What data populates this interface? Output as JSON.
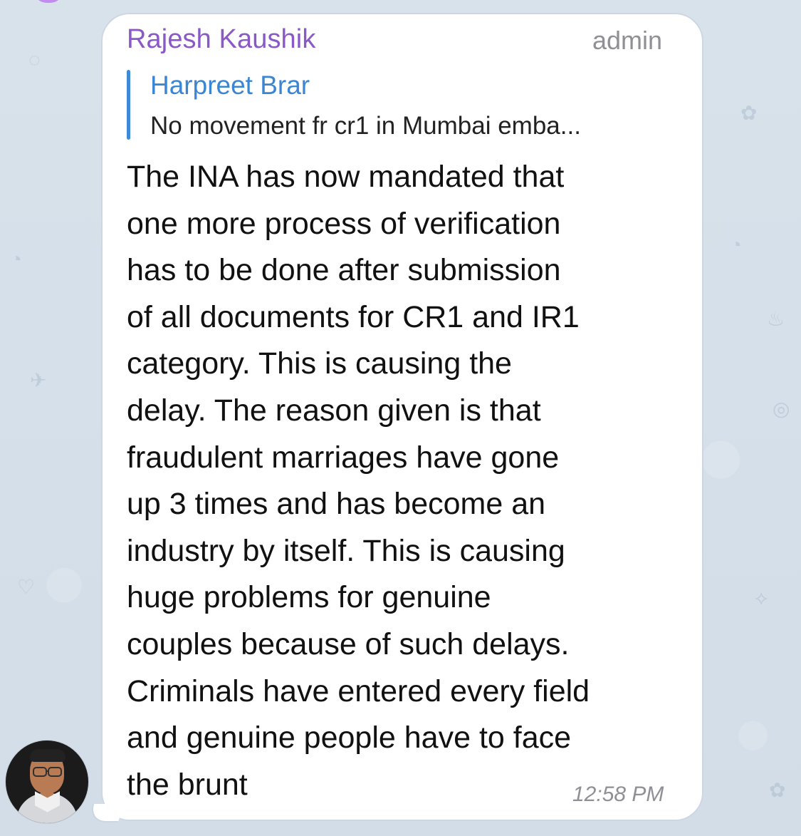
{
  "message": {
    "sender_name": "Rajesh Kaushik",
    "role_label": "admin",
    "reply": {
      "author": "Harpreet Brar",
      "excerpt": "No movement fr cr1 in Mumbai emba..."
    },
    "text": "The INA has now mandated that\none more process of verification\nhas to be done after submission\nof all documents for CR1 and IR1\ncategory. This is causing the\ndelay. The reason given is that\nfraudulent marriages have gone\nup 3 times and has become an\nindustry by itself. This is causing\nhuge problems for genuine\ncouples because of such delays.\nCriminals have entered every field\nand genuine people have to face\nthe brunt",
    "time": "12:58 PM"
  },
  "colors": {
    "sender_name": "#8a59c7",
    "reply_author": "#3b86d4",
    "reply_bar": "#3f8ad6",
    "meta_text": "#8f8f95",
    "bubble_border": "#cdd7e3",
    "wallpaper": "#d9e2ec"
  },
  "icons": {
    "avatar": "sender-avatar-photo"
  }
}
